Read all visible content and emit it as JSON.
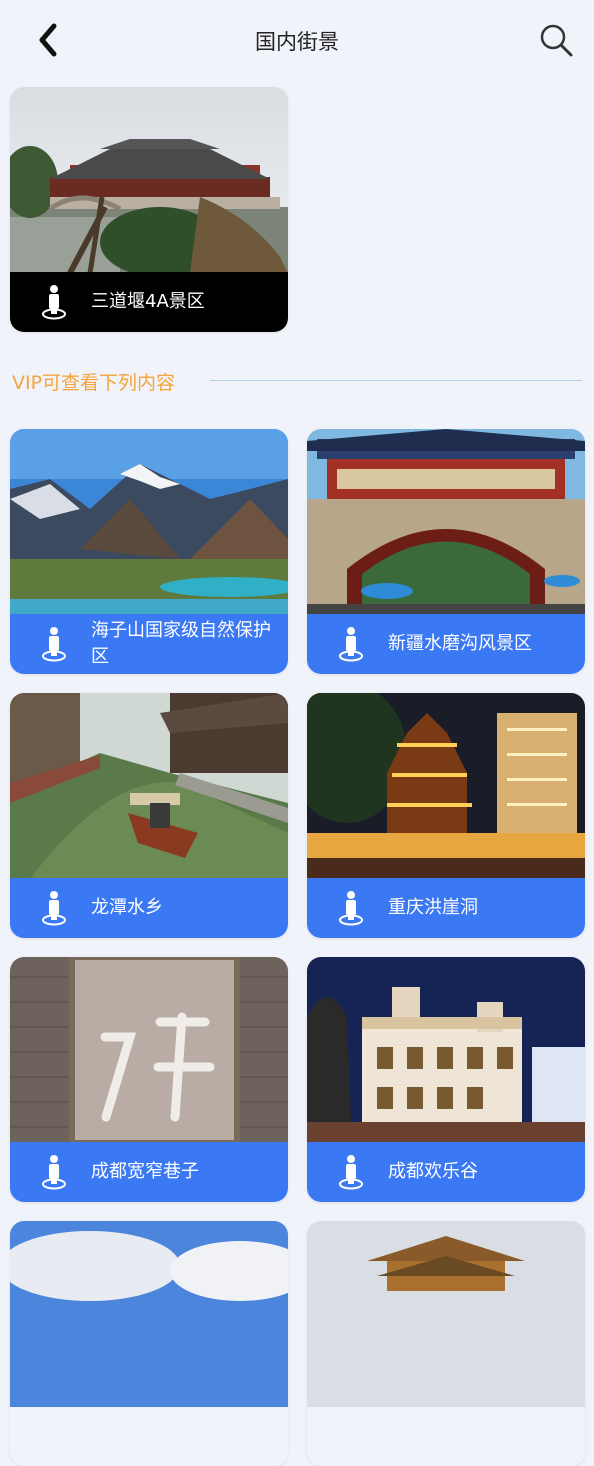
{
  "header": {
    "title": "国内街景"
  },
  "featured": {
    "label": "三道堰4A景区"
  },
  "section": {
    "title": "VIP可查看下列内容"
  },
  "spots": [
    {
      "label": "海子山国家级自然保护区"
    },
    {
      "label": "新疆水磨沟风景区"
    },
    {
      "label": "龙潭水乡"
    },
    {
      "label": "重庆洪崖洞"
    },
    {
      "label": "成都宽窄巷子"
    },
    {
      "label": "成都欢乐谷"
    }
  ],
  "colors": {
    "accent": "#3b79f4",
    "section_title": "#f3a43a",
    "background": "#f1f3fa"
  },
  "icons": {
    "back": "chevron-left-icon",
    "search": "search-icon",
    "pin": "person-pin-icon"
  }
}
